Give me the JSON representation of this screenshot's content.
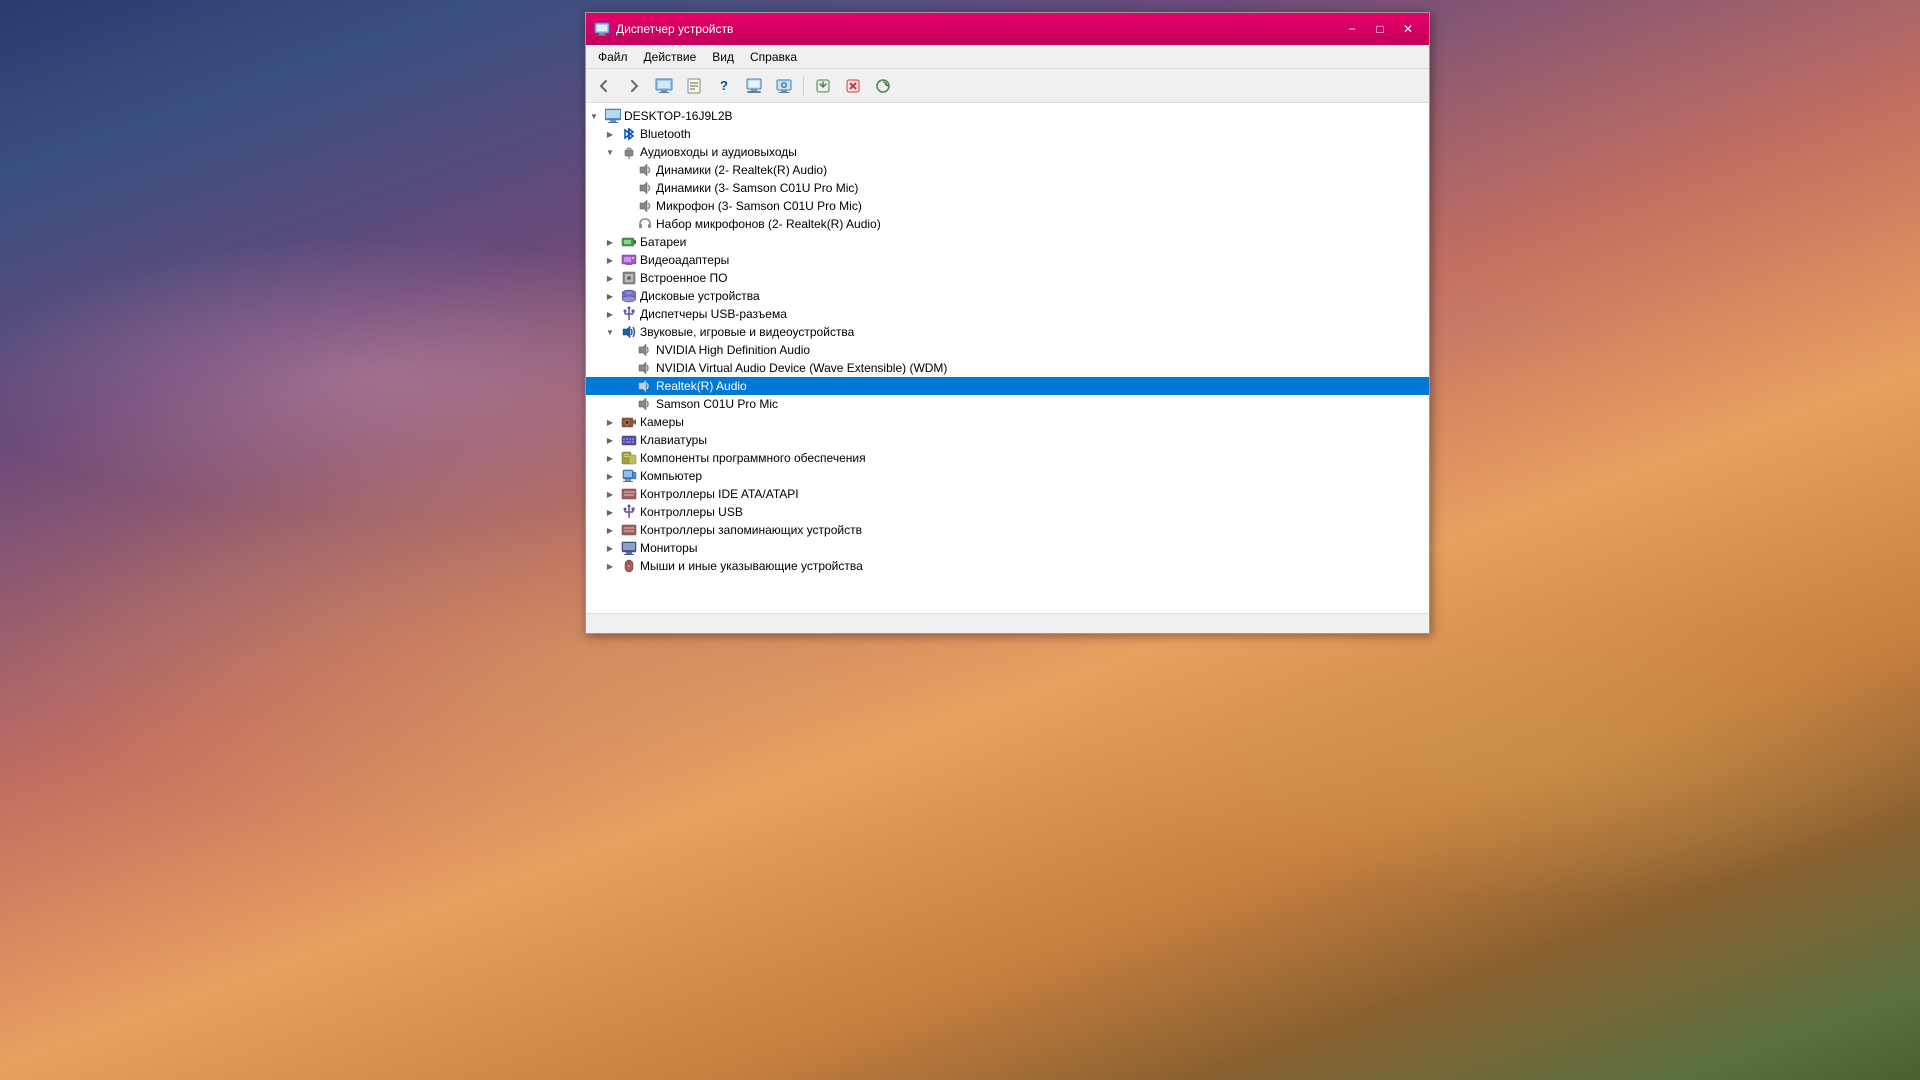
{
  "desktop": {
    "bg": "sunset landscape"
  },
  "window": {
    "title": "Диспетчер устройств",
    "icon": "🖥",
    "minimize_label": "−",
    "maximize_label": "□",
    "close_label": "✕"
  },
  "menubar": {
    "items": [
      {
        "id": "file",
        "label": "Файл"
      },
      {
        "id": "action",
        "label": "Действие"
      },
      {
        "id": "view",
        "label": "Вид"
      },
      {
        "id": "help",
        "label": "Справка"
      }
    ]
  },
  "toolbar": {
    "buttons": [
      {
        "id": "back",
        "icon": "◀",
        "label": "Назад"
      },
      {
        "id": "forward",
        "icon": "▶",
        "label": "Вперёд"
      },
      {
        "id": "computer",
        "icon": "🖥",
        "label": "Компьютер"
      },
      {
        "id": "show",
        "icon": "📋",
        "label": "Показать"
      },
      {
        "id": "help2",
        "icon": "?",
        "label": "Справка"
      },
      {
        "id": "prop",
        "icon": "📄",
        "label": "Свойства"
      },
      {
        "id": "monitor",
        "icon": "🖥",
        "label": "Монитор"
      },
      {
        "id": "update",
        "icon": "⬆",
        "label": "Обновить"
      },
      {
        "id": "remove",
        "icon": "✕",
        "label": "Удалить"
      },
      {
        "id": "scan",
        "icon": "🔍",
        "label": "Сканировать"
      }
    ]
  },
  "tree": {
    "root": {
      "label": "DESKTOP-16J9L2B",
      "expanded": true,
      "icon": "computer"
    },
    "items": [
      {
        "id": "bluetooth",
        "label": "Bluetooth",
        "icon": "bluetooth",
        "indent": 1,
        "expanded": false,
        "hasChildren": true
      },
      {
        "id": "audio-io",
        "label": "Аудиовходы и аудиовыходы",
        "icon": "audio",
        "indent": 1,
        "expanded": true,
        "hasChildren": true
      },
      {
        "id": "speaker1",
        "label": "Динамики (2- Realtek(R) Audio)",
        "icon": "audio",
        "indent": 2,
        "expanded": false,
        "hasChildren": false
      },
      {
        "id": "speaker2",
        "label": "Динамики (3- Samson C01U Pro Mic)",
        "icon": "audio",
        "indent": 2,
        "expanded": false,
        "hasChildren": false
      },
      {
        "id": "mic1",
        "label": "Микрофон (3- Samson C01U Pro Mic)",
        "icon": "audio",
        "indent": 2,
        "expanded": false,
        "hasChildren": false
      },
      {
        "id": "headset",
        "label": "Набор микрофонов (2- Realtek(R) Audio)",
        "icon": "audio",
        "indent": 2,
        "expanded": false,
        "hasChildren": false
      },
      {
        "id": "battery",
        "label": "Батареи",
        "icon": "battery",
        "indent": 1,
        "expanded": false,
        "hasChildren": true
      },
      {
        "id": "video-adapters",
        "label": "Видеоадаптеры",
        "icon": "video",
        "indent": 1,
        "expanded": false,
        "hasChildren": true
      },
      {
        "id": "firmware",
        "label": "Встроенное ПО",
        "icon": "firmware",
        "indent": 1,
        "expanded": false,
        "hasChildren": true
      },
      {
        "id": "disk",
        "label": "Дисковые устройства",
        "icon": "disk",
        "indent": 1,
        "expanded": false,
        "hasChildren": true
      },
      {
        "id": "usb-ctrl",
        "label": "Диспетчеры USB-разъема",
        "icon": "usb",
        "indent": 1,
        "expanded": false,
        "hasChildren": true
      },
      {
        "id": "sound-devices",
        "label": "Звуковые, игровые и видеоустройства",
        "icon": "sound",
        "indent": 1,
        "expanded": true,
        "hasChildren": true
      },
      {
        "id": "nvidia-hd",
        "label": "NVIDIA High Definition Audio",
        "icon": "audio",
        "indent": 2,
        "expanded": false,
        "hasChildren": false
      },
      {
        "id": "nvidia-virt",
        "label": "NVIDIA Virtual Audio Device (Wave Extensible) (WDM)",
        "icon": "audio",
        "indent": 2,
        "expanded": false,
        "hasChildren": false
      },
      {
        "id": "realtek",
        "label": "Realtek(R) Audio",
        "icon": "audio",
        "indent": 2,
        "expanded": false,
        "hasChildren": false,
        "selected": true
      },
      {
        "id": "samson",
        "label": "Samson C01U Pro Mic",
        "icon": "audio",
        "indent": 2,
        "expanded": false,
        "hasChildren": false
      },
      {
        "id": "cameras",
        "label": "Камеры",
        "icon": "camera",
        "indent": 1,
        "expanded": false,
        "hasChildren": true
      },
      {
        "id": "keyboard",
        "label": "Клавиатуры",
        "icon": "keyboard",
        "indent": 1,
        "expanded": false,
        "hasChildren": true
      },
      {
        "id": "software-comp",
        "label": "Компоненты программного обеспечения",
        "icon": "software",
        "indent": 1,
        "expanded": false,
        "hasChildren": true
      },
      {
        "id": "computer-node",
        "label": "Компьютер",
        "icon": "pc",
        "indent": 1,
        "expanded": false,
        "hasChildren": true
      },
      {
        "id": "ide-ctrl",
        "label": "Контроллеры IDE ATA/ATAPI",
        "icon": "storage",
        "indent": 1,
        "expanded": false,
        "hasChildren": true
      },
      {
        "id": "usb-ctrl2",
        "label": "Контроллеры USB",
        "icon": "usb",
        "indent": 1,
        "expanded": false,
        "hasChildren": true
      },
      {
        "id": "storage-ctrl",
        "label": "Контроллеры запоминающих устройств",
        "icon": "storage",
        "indent": 1,
        "expanded": false,
        "hasChildren": true
      },
      {
        "id": "monitors",
        "label": "Мониторы",
        "icon": "monitor",
        "indent": 1,
        "expanded": false,
        "hasChildren": true
      },
      {
        "id": "mice",
        "label": "Мыши и иные указывающие устройства",
        "icon": "pc",
        "indent": 1,
        "expanded": false,
        "hasChildren": true,
        "partial": true
      }
    ]
  }
}
